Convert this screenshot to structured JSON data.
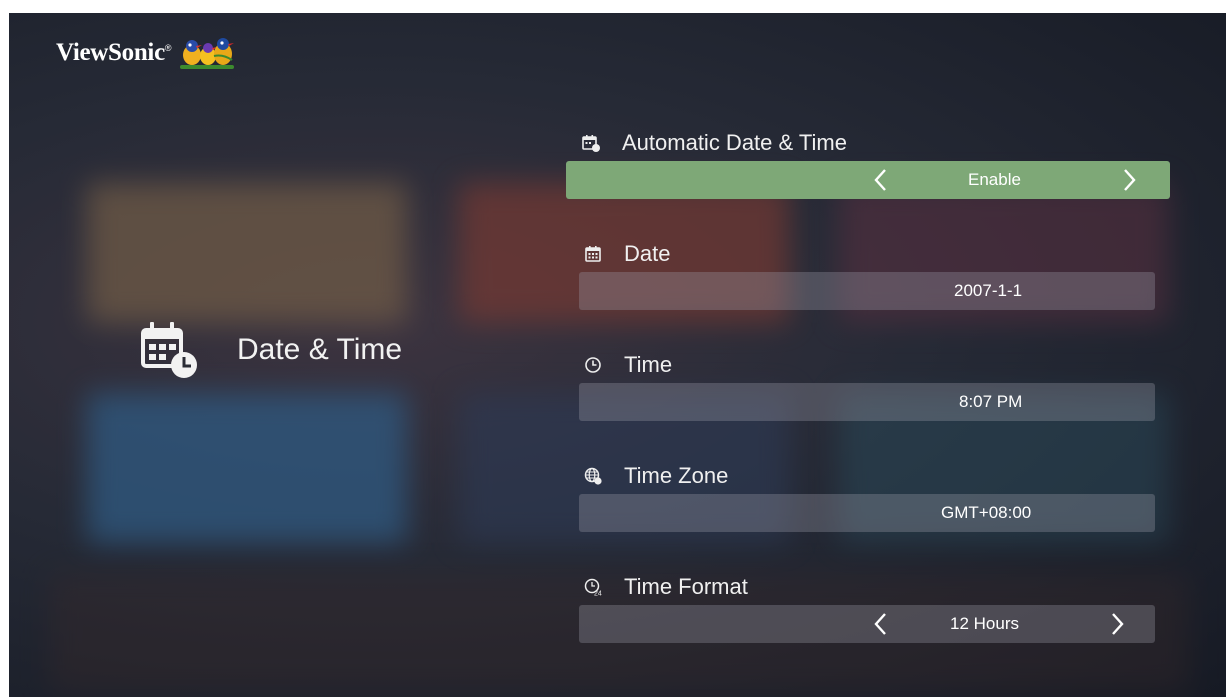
{
  "brand": {
    "name": "ViewSonic",
    "trademark": "®"
  },
  "category": {
    "title": "Date & Time",
    "icon": "calendar-clock-icon"
  },
  "settings": [
    {
      "label": "Automatic Date & Time",
      "value": "Enable",
      "icon": "calendar-sync-icon",
      "selected": true,
      "has_arrows": true
    },
    {
      "label": "Date",
      "value": "2007-1-1",
      "icon": "calendar-icon",
      "selected": false,
      "has_arrows": false
    },
    {
      "label": "Time",
      "value": "8:07 PM",
      "icon": "clock-icon",
      "selected": false,
      "has_arrows": false
    },
    {
      "label": "Time Zone",
      "value": "GMT+08:00",
      "icon": "globe-clock-icon",
      "selected": false,
      "has_arrows": false
    },
    {
      "label": "Time Format",
      "value": "12 Hours",
      "icon": "clock-24-icon",
      "selected": false,
      "has_arrows": true
    }
  ],
  "colors": {
    "selected_bar": "#7ea877",
    "bar": "rgba(160,160,170,0.32)",
    "text": "#ffffff"
  }
}
